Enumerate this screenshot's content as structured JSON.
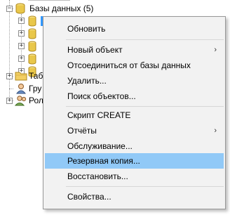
{
  "tree": {
    "databases_label": "Базы данных (5)",
    "tables_label": "Таб",
    "groups_label": "Гру",
    "roles_label": "Рол",
    "expand_glyph": "+",
    "collapse_glyph": "−"
  },
  "menu": {
    "items": [
      {
        "label": "Обновить"
      },
      {
        "label": "Новый объект",
        "arrow": "›"
      },
      {
        "label": "Отсоединиться от базы данных"
      },
      {
        "label": "Удалить..."
      },
      {
        "label": "Поиск объектов..."
      },
      {
        "label": "Скрипт CREATE"
      },
      {
        "label": "Отчёты",
        "arrow": "›"
      },
      {
        "label": "Обслуживание..."
      },
      {
        "label": "Резервная копия...",
        "highlighted": true
      },
      {
        "label": "Восстановить..."
      },
      {
        "label": "Свойства..."
      }
    ]
  },
  "colors": {
    "highlight": "#91c9f7",
    "menu_bg": "#f2f2f2",
    "selection": "#3399ff",
    "db_icon": "#e9c74a"
  }
}
